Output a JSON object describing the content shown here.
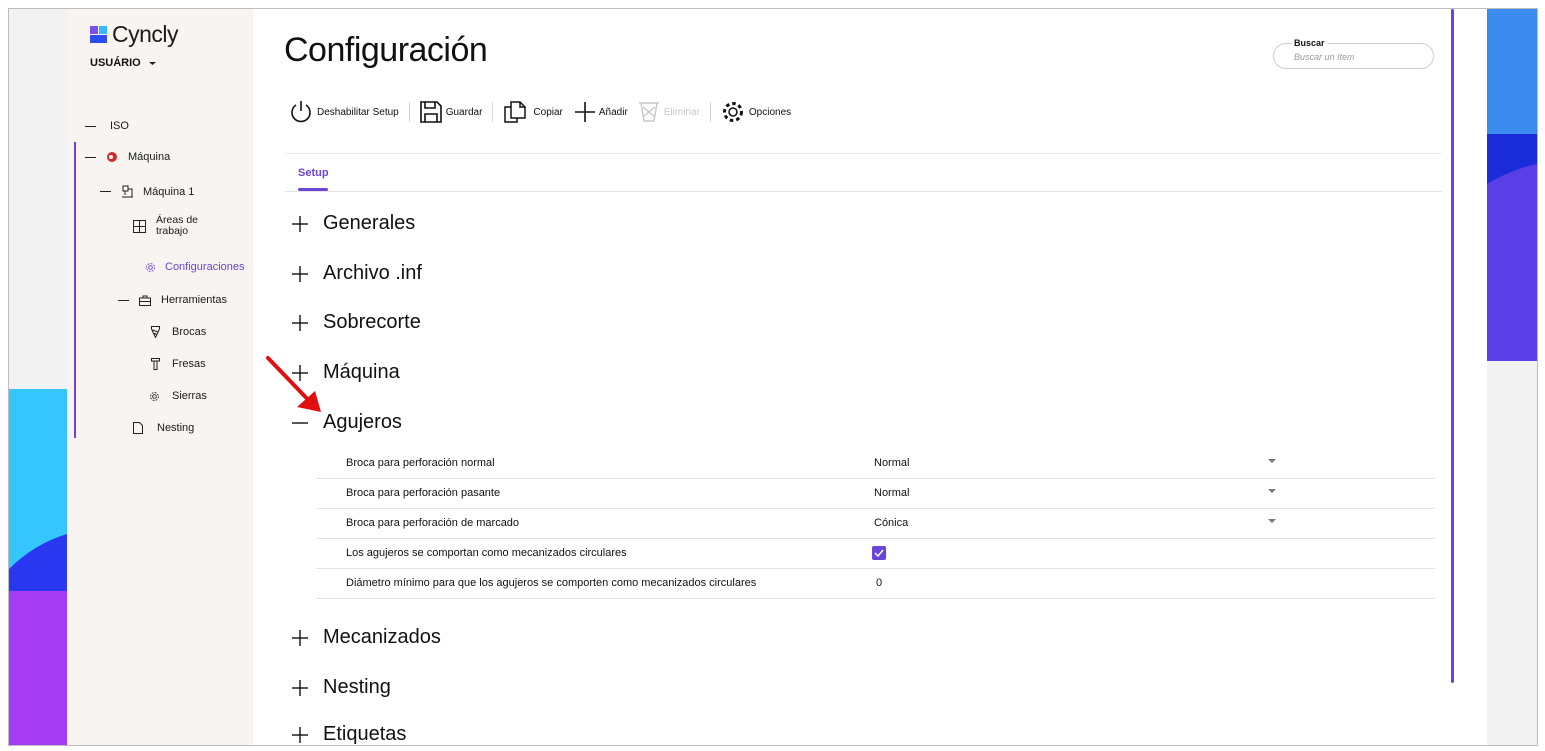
{
  "brand": {
    "name": "Cyncly"
  },
  "user": {
    "label": "USUÁRIO"
  },
  "sidebar": {
    "items": [
      {
        "label": "ISO"
      },
      {
        "label": "Máquina"
      },
      {
        "label": "Máquina 1"
      },
      {
        "label": "Áreas de trabajo"
      },
      {
        "label": "Configuraciones"
      },
      {
        "label": "Herramientas"
      },
      {
        "label": "Brocas"
      },
      {
        "label": "Fresas"
      },
      {
        "label": "Sierras"
      },
      {
        "label": "Nesting"
      }
    ]
  },
  "page": {
    "title": "Configuración"
  },
  "search": {
    "label": "Buscar",
    "placeholder": "Buscar un ítem"
  },
  "toolbar": {
    "disable": "Deshabilitar Setup",
    "save": "Guardar",
    "copy": "Copiar",
    "add": "Añadir",
    "delete": "Eliminar",
    "options": "Opciones"
  },
  "tabs": {
    "setup": "Setup"
  },
  "sections": {
    "generales": "Generales",
    "archivo": "Archivo .inf",
    "sobrecorte": "Sobrecorte",
    "maquina": "Máquina",
    "agujeros": "Agujeros",
    "mecanizados": "Mecanizados",
    "nesting": "Nesting",
    "etiquetas": "Etiquetas"
  },
  "agujeros_rows": [
    {
      "label": "Broca para perforación normal",
      "value": "Normal"
    },
    {
      "label": "Broca para perforación pasante",
      "value": "Normal"
    },
    {
      "label": "Broca para perforación de marcado",
      "value": "Cónica"
    },
    {
      "label": "Los agujeros se comportan como mecanizados circulares",
      "checked": true
    },
    {
      "label": "Diámetro mínimo para que los agujeros se comporten como mecanizados circulares",
      "value": "0"
    }
  ],
  "colors": {
    "accent": "#6a45d8",
    "brand_blue": "#3b5bdb",
    "arrow": "#e01010"
  }
}
